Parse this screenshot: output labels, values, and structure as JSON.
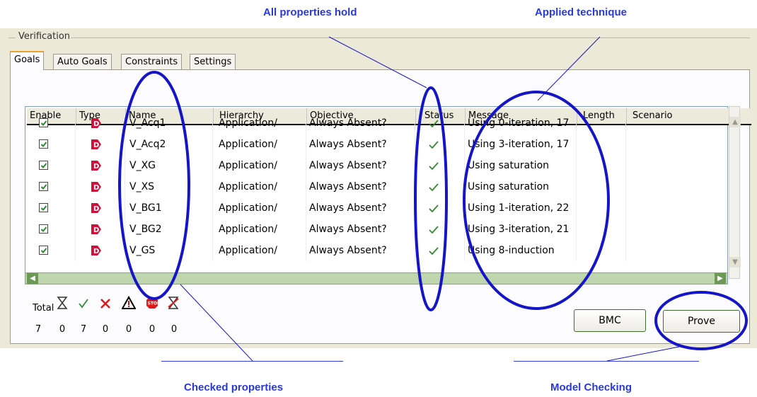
{
  "callouts": {
    "all_properties_hold": "All properties hold",
    "applied_technique": "Applied technique",
    "checked_properties": "Checked properties",
    "model_checking": "Model Checking"
  },
  "panel": {
    "title": "Verification",
    "tabs": [
      "Goals",
      "Auto Goals",
      "Constraints",
      "Settings"
    ],
    "active_tab": "Goals"
  },
  "table": {
    "columns": [
      "Enable",
      "Type",
      "Name",
      "Hierarchy",
      "Objective",
      "Status",
      "Message",
      "Length",
      "Scenario"
    ],
    "rows": [
      {
        "name": "V_Acq1",
        "hierarchy": "Application/",
        "objective": "Always Absent?",
        "message": "Using 0-iteration, 17"
      },
      {
        "name": "V_Acq2",
        "hierarchy": "Application/",
        "objective": "Always Absent?",
        "message": "Using 3-iteration, 17"
      },
      {
        "name": "V_XG",
        "hierarchy": "Application/",
        "objective": "Always Absent?",
        "message": "Using saturation"
      },
      {
        "name": "V_XS",
        "hierarchy": "Application/",
        "objective": "Always Absent?",
        "message": "Using saturation"
      },
      {
        "name": "V_BG1",
        "hierarchy": "Application/",
        "objective": "Always Absent?",
        "message": "Using 1-iteration, 22"
      },
      {
        "name": "V_BG2",
        "hierarchy": "Application/",
        "objective": "Always Absent?",
        "message": "Using 3-iteration, 21"
      },
      {
        "name": "V_GS",
        "hierarchy": "Application/",
        "objective": "Always Absent?",
        "message": "Using 8-induction"
      }
    ]
  },
  "summary": {
    "total_label": "Total",
    "icons": [
      "hourglass-icon",
      "check-icon",
      "cross-icon",
      "warning-icon",
      "stop-icon",
      "hourglass-crossed-icon"
    ],
    "values": [
      "7",
      "0",
      "7",
      "0",
      "0",
      "0",
      "0"
    ]
  },
  "buttons": {
    "bmc": "BMC",
    "prove": "Prove"
  },
  "colors": {
    "annotation": "#1515c8",
    "callout_text": "#2a3ad6",
    "check_green": "#2e8b2e",
    "type_red": "#d0103a",
    "button_border": "#3d6e2c"
  }
}
